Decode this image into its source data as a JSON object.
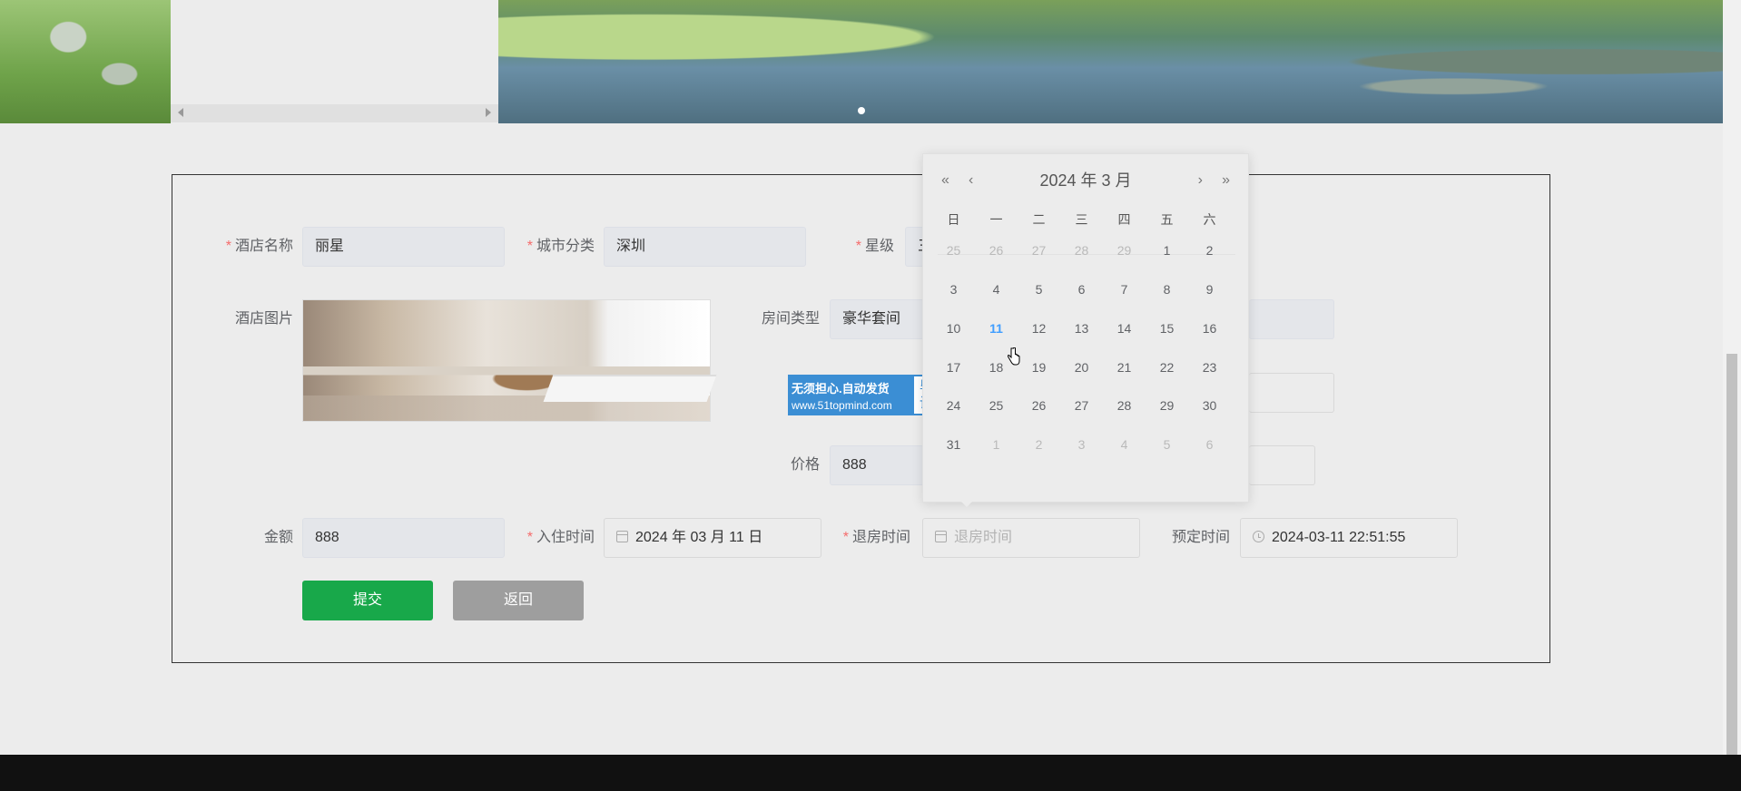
{
  "form": {
    "hotel_name_label": "酒店名称",
    "hotel_name_value": "丽星",
    "city_label": "城市分类",
    "city_value": "深圳",
    "star_label": "星级",
    "star_value": "三",
    "image_label": "酒店图片",
    "room_type_label": "房间类型",
    "room_type_value": "豪华套间",
    "price_label": "价格",
    "price_value": "888",
    "amount_label": "金额",
    "amount_value": "888",
    "checkin_label": "入住时间",
    "checkin_value": "2024 年 03 月 11 日",
    "checkout_label": "退房时间",
    "checkout_placeholder": "退房时间",
    "booking_time_label": "预定时间",
    "booking_time_value": "2024-03-11 22:51:55",
    "required_mark": "*"
  },
  "buttons": {
    "submit": "提交",
    "back": "返回"
  },
  "watermark": {
    "line1": "无须担心.自动发货",
    "line2": "www.51topmind.com",
    "badge": "毕业设计"
  },
  "date_picker": {
    "header": "2024 年  3 月",
    "prev_year": "«",
    "prev_month": "‹",
    "next_month": "›",
    "next_year": "»",
    "weekdays": [
      "日",
      "一",
      "二",
      "三",
      "四",
      "五",
      "六"
    ],
    "weeks": [
      [
        "25",
        "26",
        "27",
        "28",
        "29",
        "1",
        "2"
      ],
      [
        "3",
        "4",
        "5",
        "6",
        "7",
        "8",
        "9"
      ],
      [
        "10",
        "11",
        "12",
        "13",
        "14",
        "15",
        "16"
      ],
      [
        "17",
        "18",
        "19",
        "20",
        "21",
        "22",
        "23"
      ],
      [
        "24",
        "25",
        "26",
        "27",
        "28",
        "29",
        "30"
      ],
      [
        "31",
        "1",
        "2",
        "3",
        "4",
        "5",
        "6"
      ]
    ],
    "selected_day": "11",
    "colors": {
      "today": "#409eff",
      "muted": "#b9b9b9"
    }
  },
  "colors": {
    "submit_button": "#18a84a",
    "back_button": "#9e9e9e",
    "required": "#f56c6c",
    "footer": "#111111"
  }
}
